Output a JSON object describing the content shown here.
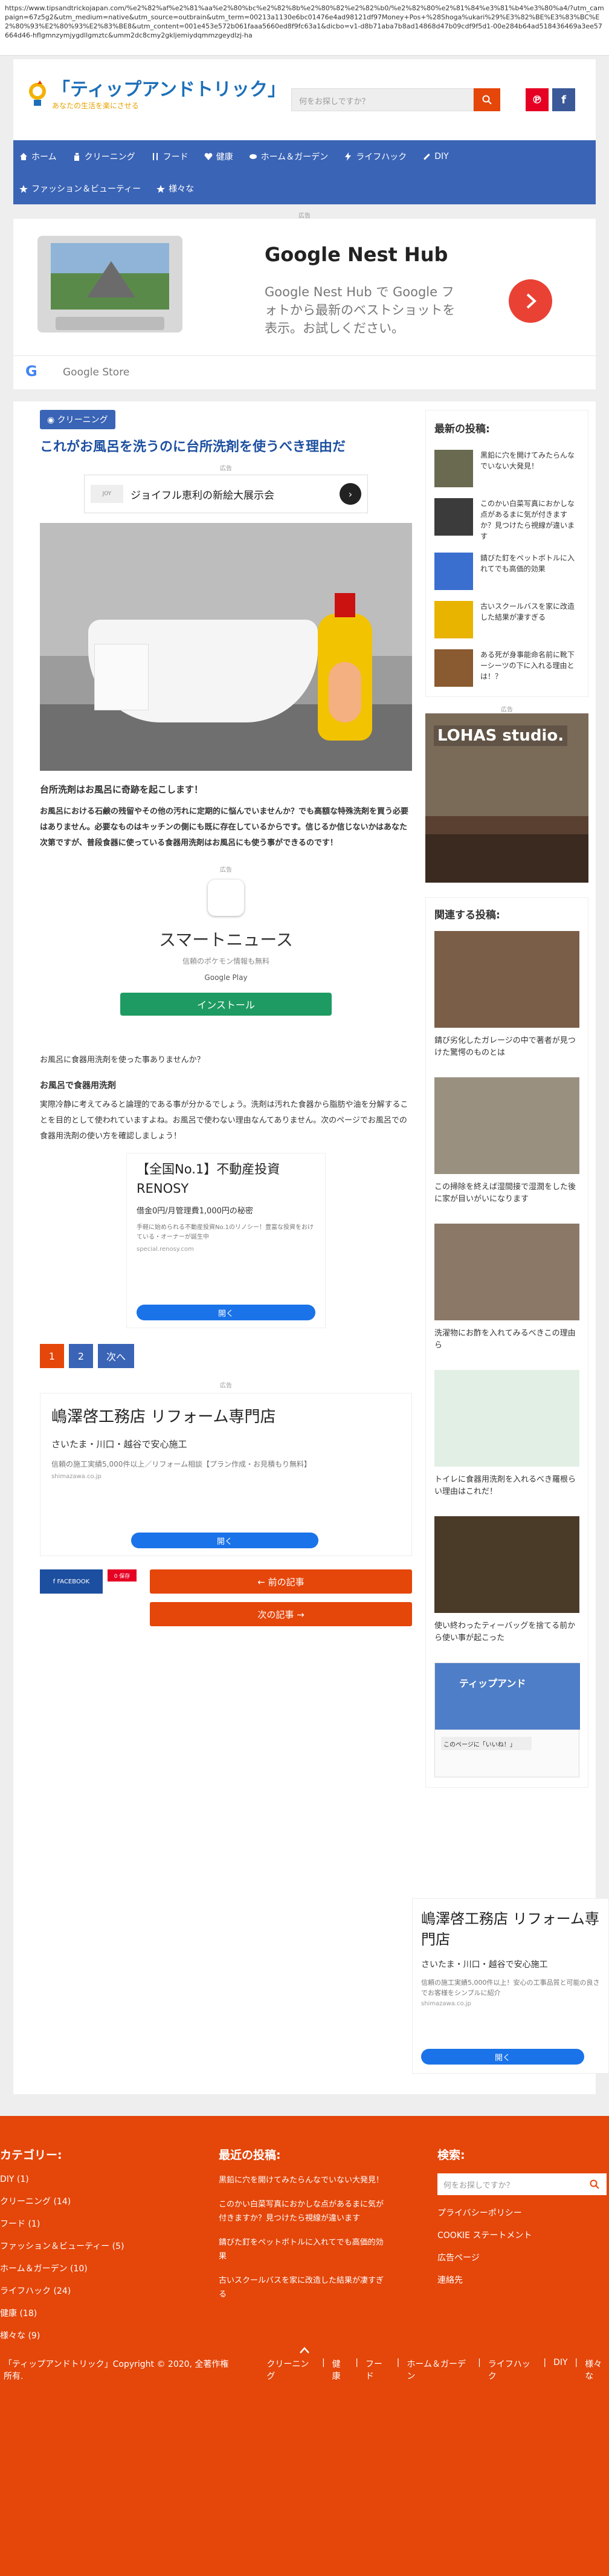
{
  "url": "https://www.tipsandtrickojapan.com/%e2%82%af%e2%81%aa%e2%80%bc%e2%82%8b%e2%80%82%e2%82%b0/%e2%82%80%e2%81%84%e3%81%b4%e3%80%a4/?utm_campaign=67z5g2&utm_medium=native&utm_source=outbrain&utm_term=00213a1130e6bc01476e4ad98121df97Money+Pos+%28Shoga%ukari%29%E3%82%BE%E3%83%BC%E2%80%93%E2%80%93%E2%83%BE8&utm_content=001e453e572b061faaa5660ed8f9fc63a1&dicbo=v1-d8b71aba7b8ad14868d47b09cdf9f5d1-00e284b64ad518436469a3ee57664d46-hflgmnzymjygdllgmztc&umm2dc8cmy2gkljemiydqmmzgeydlzj-ha",
  "header": {
    "logo_title": "「ティップアンドトリック」",
    "logo_sub": "あなたの生活を楽にさせる",
    "search_placeholder": "何をお探しですか？"
  },
  "nav": [
    [
      "ホーム",
      "クリーニング",
      "フード",
      "健康",
      "ホーム＆ガーデン",
      "ライフハック",
      "DIY"
    ],
    [
      "ファッション＆ビューティー",
      "様々な"
    ]
  ],
  "ad_label": "広告",
  "bigad": {
    "title": "Google Nest Hub",
    "body": "Google Nest Hub で Google フォトから最新のベストショットを表示。お試しください。",
    "source": "Google Store"
  },
  "article": {
    "category": "クリーニング",
    "title": "これがお風呂を洗うのに台所洗剤を使うべき理由だ",
    "ad_text": "ジョイフル恵利の新絵大展示会",
    "lead": "台所洗剤はお風呂に奇跡を起こします！",
    "body1": "お風呂における石鹸の残留やその他の汚れに定期的に悩んでいませんか？でも高額な特殊洗剤を買う必要はありません。必要なものはキッチンの側にも既に存在しているからです。信じるか信じないかはあなた次第ですが、普段食器に使っている食器用洗剤はお風呂にも使う事ができるのです！",
    "app_ad": {
      "label": "広告",
      "name": "スマートニュース",
      "sub": "信頼のポケモン情報も無料",
      "store": "Google Play",
      "button": "インストール"
    },
    "q": "お風呂に食器用洗剤を使った事ありませんか？",
    "h3": "お風呂で食器用洗剤",
    "body2": "実際冷静に考えてみると論理的である事が分かるでしょう。洗剤は汚れた食器から脂肪や油を分解することを目的として使われていますよね。お風呂で使わない理由なんてありません。次のページでお風呂での食器用洗剤の使い方を確認しましょう！",
    "ad2": {
      "title": "【全国No.1】不動産投資RENOSY",
      "sub": "借金0円/月管理費1,000円の秘密",
      "desc": "手軽に始められる不動産投資No.1のリノシー！豊富な投資をおけている・オーナーが誕生中",
      "url": "special.renosy.com",
      "button": "開く"
    },
    "pages": [
      "1",
      "2",
      "次へ"
    ],
    "ad3": {
      "title": "嶋澤啓工務店 リフォーム専門店",
      "sub": "さいたま・川口・越谷で安心施工",
      "desc": "信頼の施工実績5,000件以上／リフォーム相談【プラン作成・お見積もり無料】",
      "url": "shimazawa.co.jp",
      "button": "開く"
    },
    "share": "FACEBOOK",
    "share2": "0 保存",
    "prev": "← 前の記事",
    "next": "次の記事 →"
  },
  "sidebar": {
    "recent_title": "最新の投稿:",
    "recent": [
      "黒鉛に穴を開けてみたらんなでいない大発見！",
      "このかい白菜写真におかしな点があるまに気が付きますか？見つけたら視線が違います",
      "錆びた釘をペットボトルに入れてでも高価的効果",
      "古いスクールバスを家に改造した結果が凄すぎる",
      "ある死が身事能命名前に靴下ーシーツの下に入れる理由とは！？"
    ],
    "lohas": "LOHAS studio.",
    "related_title": "関連する投稿:",
    "related": [
      "錆び劣化したガレージの中で著者が見つけた驚愕のものとは",
      "この掃除を終えば湿間接で湿潤をした後に家が目いがいになります",
      "洗濯物にお酢を入れてみるべきこの理由ら",
      "トイレに食器用洗剤を入れるべき羅根らい理由はこれだ！",
      "使い終わったティーバッグを捨てる前から使い事が起こった"
    ],
    "fb_widget": "ティップアンド",
    "fb_like": "このページに「いいね！」",
    "ad": {
      "title": "嶋澤啓工務店 リフォーム専門店",
      "sub": "さいたま・川口・越谷で安心施工",
      "desc": "信頼の施工実績5,000件以上！安心の工事品質と可能の良さでお客様をシンプルに紹介",
      "url": "shimazawa.co.jp",
      "button": "開く"
    }
  },
  "footer": {
    "cat_title": "カテゴリー:",
    "cats": [
      "DIY (1)",
      "クリーニング (14)",
      "フード (1)",
      "ファッション＆ビューティー (5)",
      "ホーム＆ガーデン (10)",
      "ライフハック (24)",
      "健康 (18)",
      "様々な (9)"
    ],
    "recent_title": "最近の投稿:",
    "recent": [
      "黒鉛に穴を開けてみたらんなでいない大発見！",
      "このかい白菜写真におかしな点があるまに気が付きますか？見つけたら視線が違います",
      "錆びた釘をペットボトルに入れてでも高価的効果",
      "古いスクールバスを家に改造した結果が凄すぎる"
    ],
    "search_title": "検索:",
    "search_placeholder": "何をお探しですか？",
    "links": [
      "プライバシーポリシー",
      "COOKIE ステートメント",
      "広告ページ",
      "連絡先"
    ],
    "copyright": "「ティップアンドトリック」Copyright © 2020, 全著作権所有.",
    "bottom_nav": [
      "クリーニング",
      "健康",
      "フード",
      "ホーム＆ガーデン",
      "ライフハック",
      "DIY",
      "様々な"
    ]
  }
}
